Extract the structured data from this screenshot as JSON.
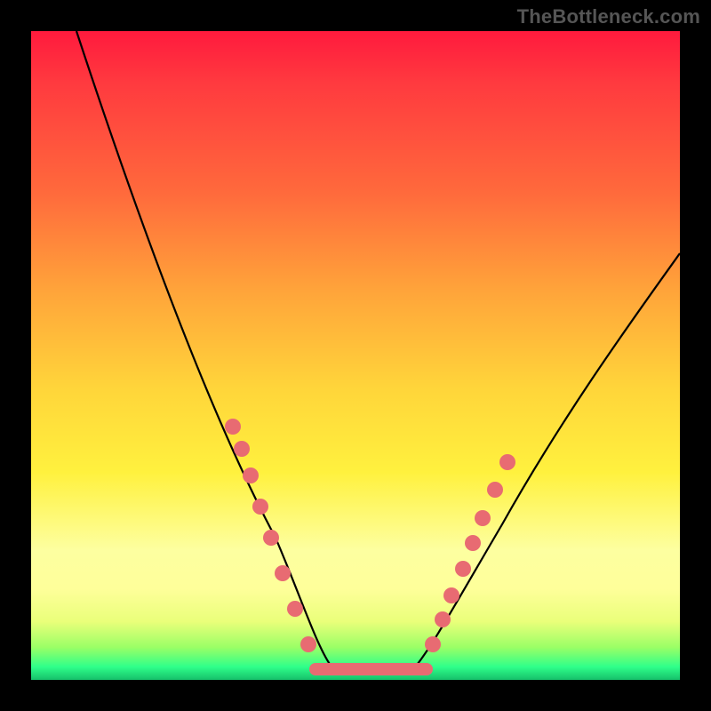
{
  "watermark": "TheBottleneck.com",
  "chart_data": {
    "type": "line",
    "title": "",
    "xlabel": "",
    "ylabel": "",
    "xlim": [
      0,
      100
    ],
    "ylim": [
      0,
      100
    ],
    "background_gradient_stops": [
      {
        "pos": 0,
        "color": "#ff1a3d"
      },
      {
        "pos": 25,
        "color": "#ff6a3c"
      },
      {
        "pos": 55,
        "color": "#ffd53a"
      },
      {
        "pos": 80,
        "color": "#fdffa0"
      },
      {
        "pos": 95,
        "color": "#9aff66"
      },
      {
        "pos": 100,
        "color": "#16c06a"
      }
    ],
    "series": [
      {
        "name": "left-branch",
        "x": [
          7,
          12,
          18,
          24,
          30,
          34,
          38,
          42,
          45
        ],
        "y": [
          100,
          86,
          72,
          58,
          44,
          34,
          24,
          14,
          5
        ]
      },
      {
        "name": "flat-bottom",
        "x": [
          45,
          48,
          51,
          54,
          57,
          60
        ],
        "y": [
          2,
          1.5,
          1.2,
          1.2,
          1.5,
          2
        ]
      },
      {
        "name": "right-branch",
        "x": [
          60,
          65,
          72,
          80,
          88,
          96,
          100
        ],
        "y": [
          5,
          12,
          22,
          35,
          48,
          60,
          66
        ]
      }
    ],
    "markers_left": [
      {
        "x": 30,
        "y": 40
      },
      {
        "x": 31.5,
        "y": 37
      },
      {
        "x": 33,
        "y": 33
      },
      {
        "x": 35,
        "y": 27
      },
      {
        "x": 37,
        "y": 22
      },
      {
        "x": 39,
        "y": 17
      },
      {
        "x": 41,
        "y": 12
      },
      {
        "x": 43,
        "y": 7
      }
    ],
    "markers_right": [
      {
        "x": 62,
        "y": 7
      },
      {
        "x": 63.5,
        "y": 10
      },
      {
        "x": 65,
        "y": 13
      },
      {
        "x": 67,
        "y": 17
      },
      {
        "x": 68.5,
        "y": 21
      },
      {
        "x": 70,
        "y": 25
      },
      {
        "x": 72,
        "y": 29
      },
      {
        "x": 74,
        "y": 33
      }
    ],
    "bottom_track": {
      "x1": 43,
      "x2": 62,
      "y": 1.5
    }
  }
}
